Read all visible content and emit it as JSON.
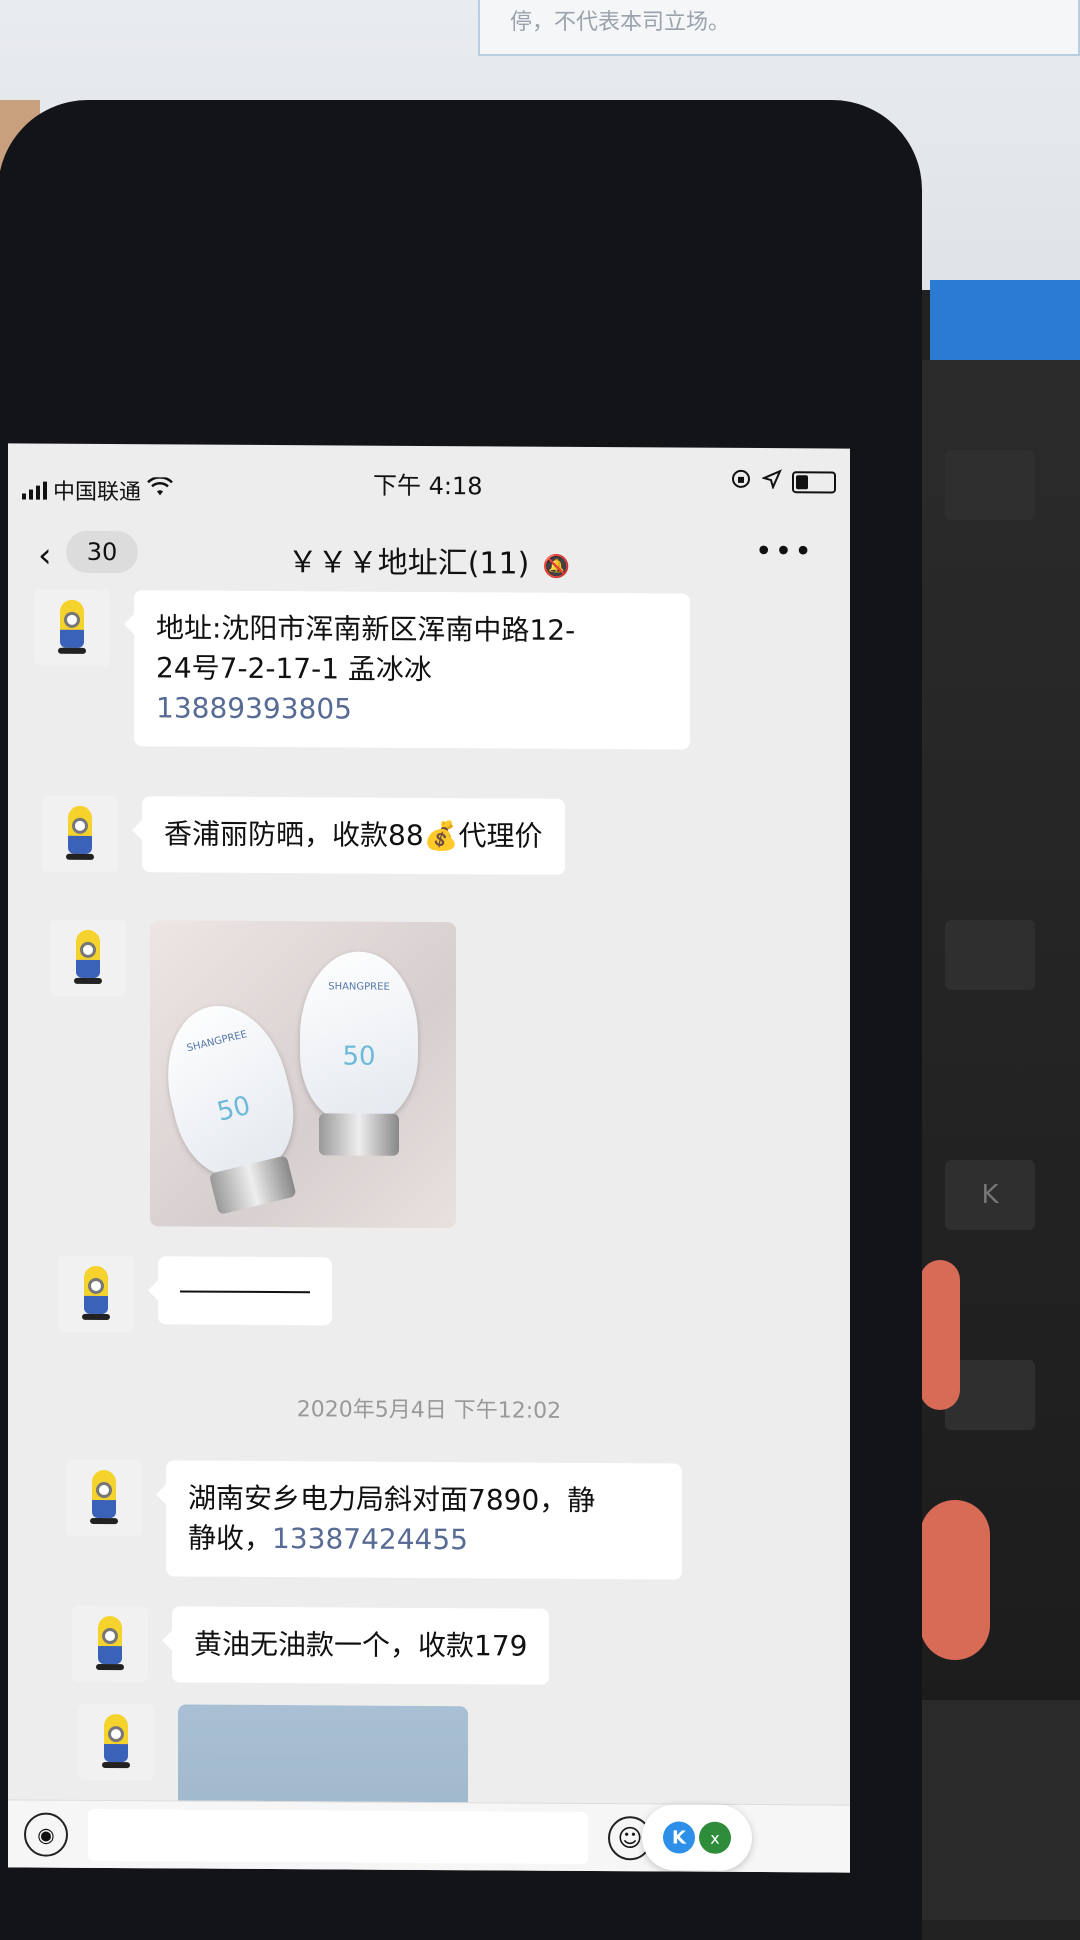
{
  "background": {
    "monitor_text": "停，不代表本司立场。",
    "key_label": "K"
  },
  "status_bar": {
    "carrier": "中国联通",
    "time": "下午 4:18"
  },
  "nav": {
    "back_count": "30",
    "title": "￥￥￥地址汇(11)",
    "more": "•••"
  },
  "messages": [
    {
      "type": "text",
      "lines": [
        "地址:沈阳市浑南新区浑南中路12-",
        "24号7-2-17-1 孟冰冰"
      ],
      "phone": "13889393805"
    },
    {
      "type": "text",
      "text": "香浦丽防晒，收款88💰代理价"
    },
    {
      "type": "image",
      "brand": "SHANGPREE",
      "spf": "50"
    },
    {
      "type": "dash"
    },
    {
      "type": "timestamp",
      "text": "2020年5月4日 下午12:02"
    },
    {
      "type": "text",
      "lines": [
        "湖南安乡电力局斜对面7890，静",
        "静收，"
      ],
      "phone": "13387424455"
    },
    {
      "type": "text",
      "text": "黄油无油款一个，收款179"
    },
    {
      "type": "image_partial"
    }
  ],
  "input_bar": {
    "widget_k": "K",
    "widget_x": "x"
  }
}
